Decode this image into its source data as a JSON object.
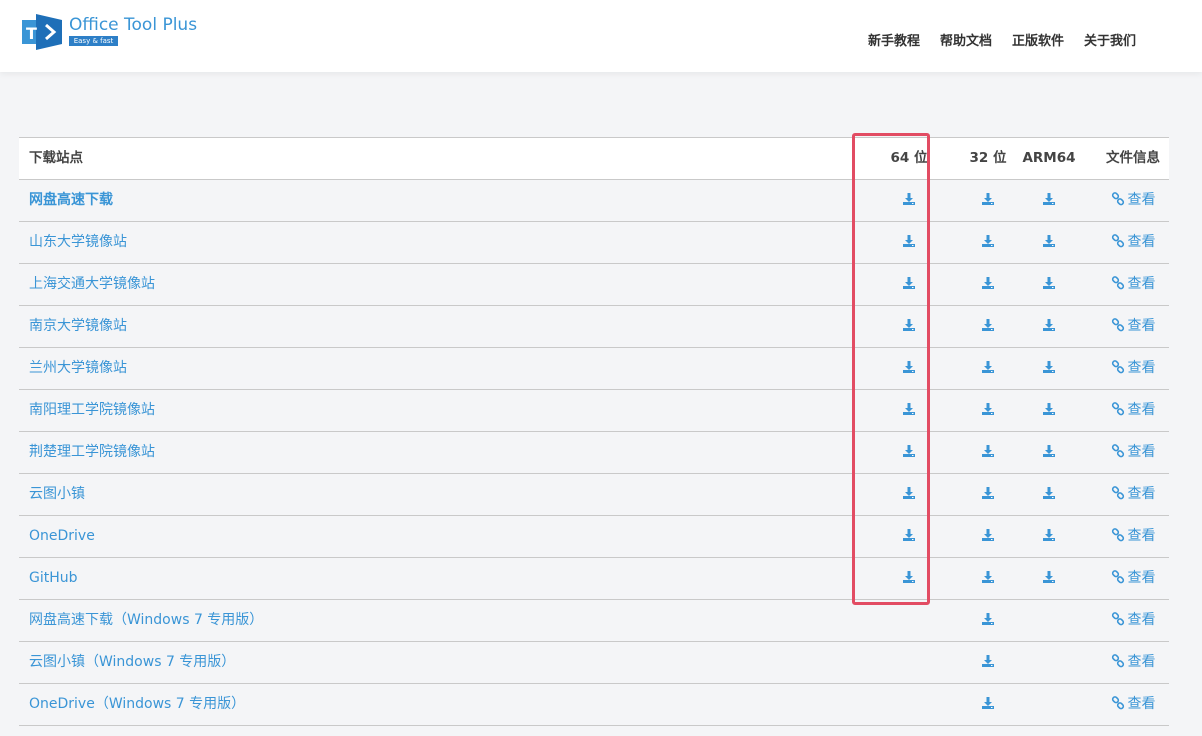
{
  "header": {
    "logo_title": "Office Tool Plus",
    "logo_tagline": "Easy & fast",
    "nav": [
      "新手教程",
      "帮助文档",
      "正版软件",
      "关于我们"
    ]
  },
  "table": {
    "columns": [
      "下载站点",
      "64 位",
      "32 位",
      "ARM64",
      "文件信息"
    ],
    "rows": [
      {
        "site": "网盘高速下载",
        "bold": true,
        "x64": true,
        "x86": true,
        "arm64": true,
        "info": "查看"
      },
      {
        "site": "山东大学镜像站",
        "bold": false,
        "x64": true,
        "x86": true,
        "arm64": true,
        "info": "查看"
      },
      {
        "site": "上海交通大学镜像站",
        "bold": false,
        "x64": true,
        "x86": true,
        "arm64": true,
        "info": "查看"
      },
      {
        "site": "南京大学镜像站",
        "bold": false,
        "x64": true,
        "x86": true,
        "arm64": true,
        "info": "查看"
      },
      {
        "site": "兰州大学镜像站",
        "bold": false,
        "x64": true,
        "x86": true,
        "arm64": true,
        "info": "查看"
      },
      {
        "site": "南阳理工学院镜像站",
        "bold": false,
        "x64": true,
        "x86": true,
        "arm64": true,
        "info": "查看"
      },
      {
        "site": "荆楚理工学院镜像站",
        "bold": false,
        "x64": true,
        "x86": true,
        "arm64": true,
        "info": "查看"
      },
      {
        "site": "云图小镇",
        "bold": false,
        "x64": true,
        "x86": true,
        "arm64": true,
        "info": "查看"
      },
      {
        "site": "OneDrive",
        "bold": false,
        "x64": true,
        "x86": true,
        "arm64": true,
        "info": "查看"
      },
      {
        "site": "GitHub",
        "bold": false,
        "x64": true,
        "x86": true,
        "arm64": true,
        "info": "查看"
      },
      {
        "site": "网盘高速下载（Windows 7 专用版）",
        "bold": false,
        "x64": false,
        "x86": true,
        "arm64": false,
        "info": "查看"
      },
      {
        "site": "云图小镇（Windows 7 专用版）",
        "bold": false,
        "x64": false,
        "x86": true,
        "arm64": false,
        "info": "查看"
      },
      {
        "site": "OneDrive（Windows 7 专用版）",
        "bold": false,
        "x64": false,
        "x86": true,
        "arm64": false,
        "info": "查看"
      }
    ]
  },
  "colors": {
    "accent": "#3a95d6",
    "highlight": "#e24c63"
  }
}
